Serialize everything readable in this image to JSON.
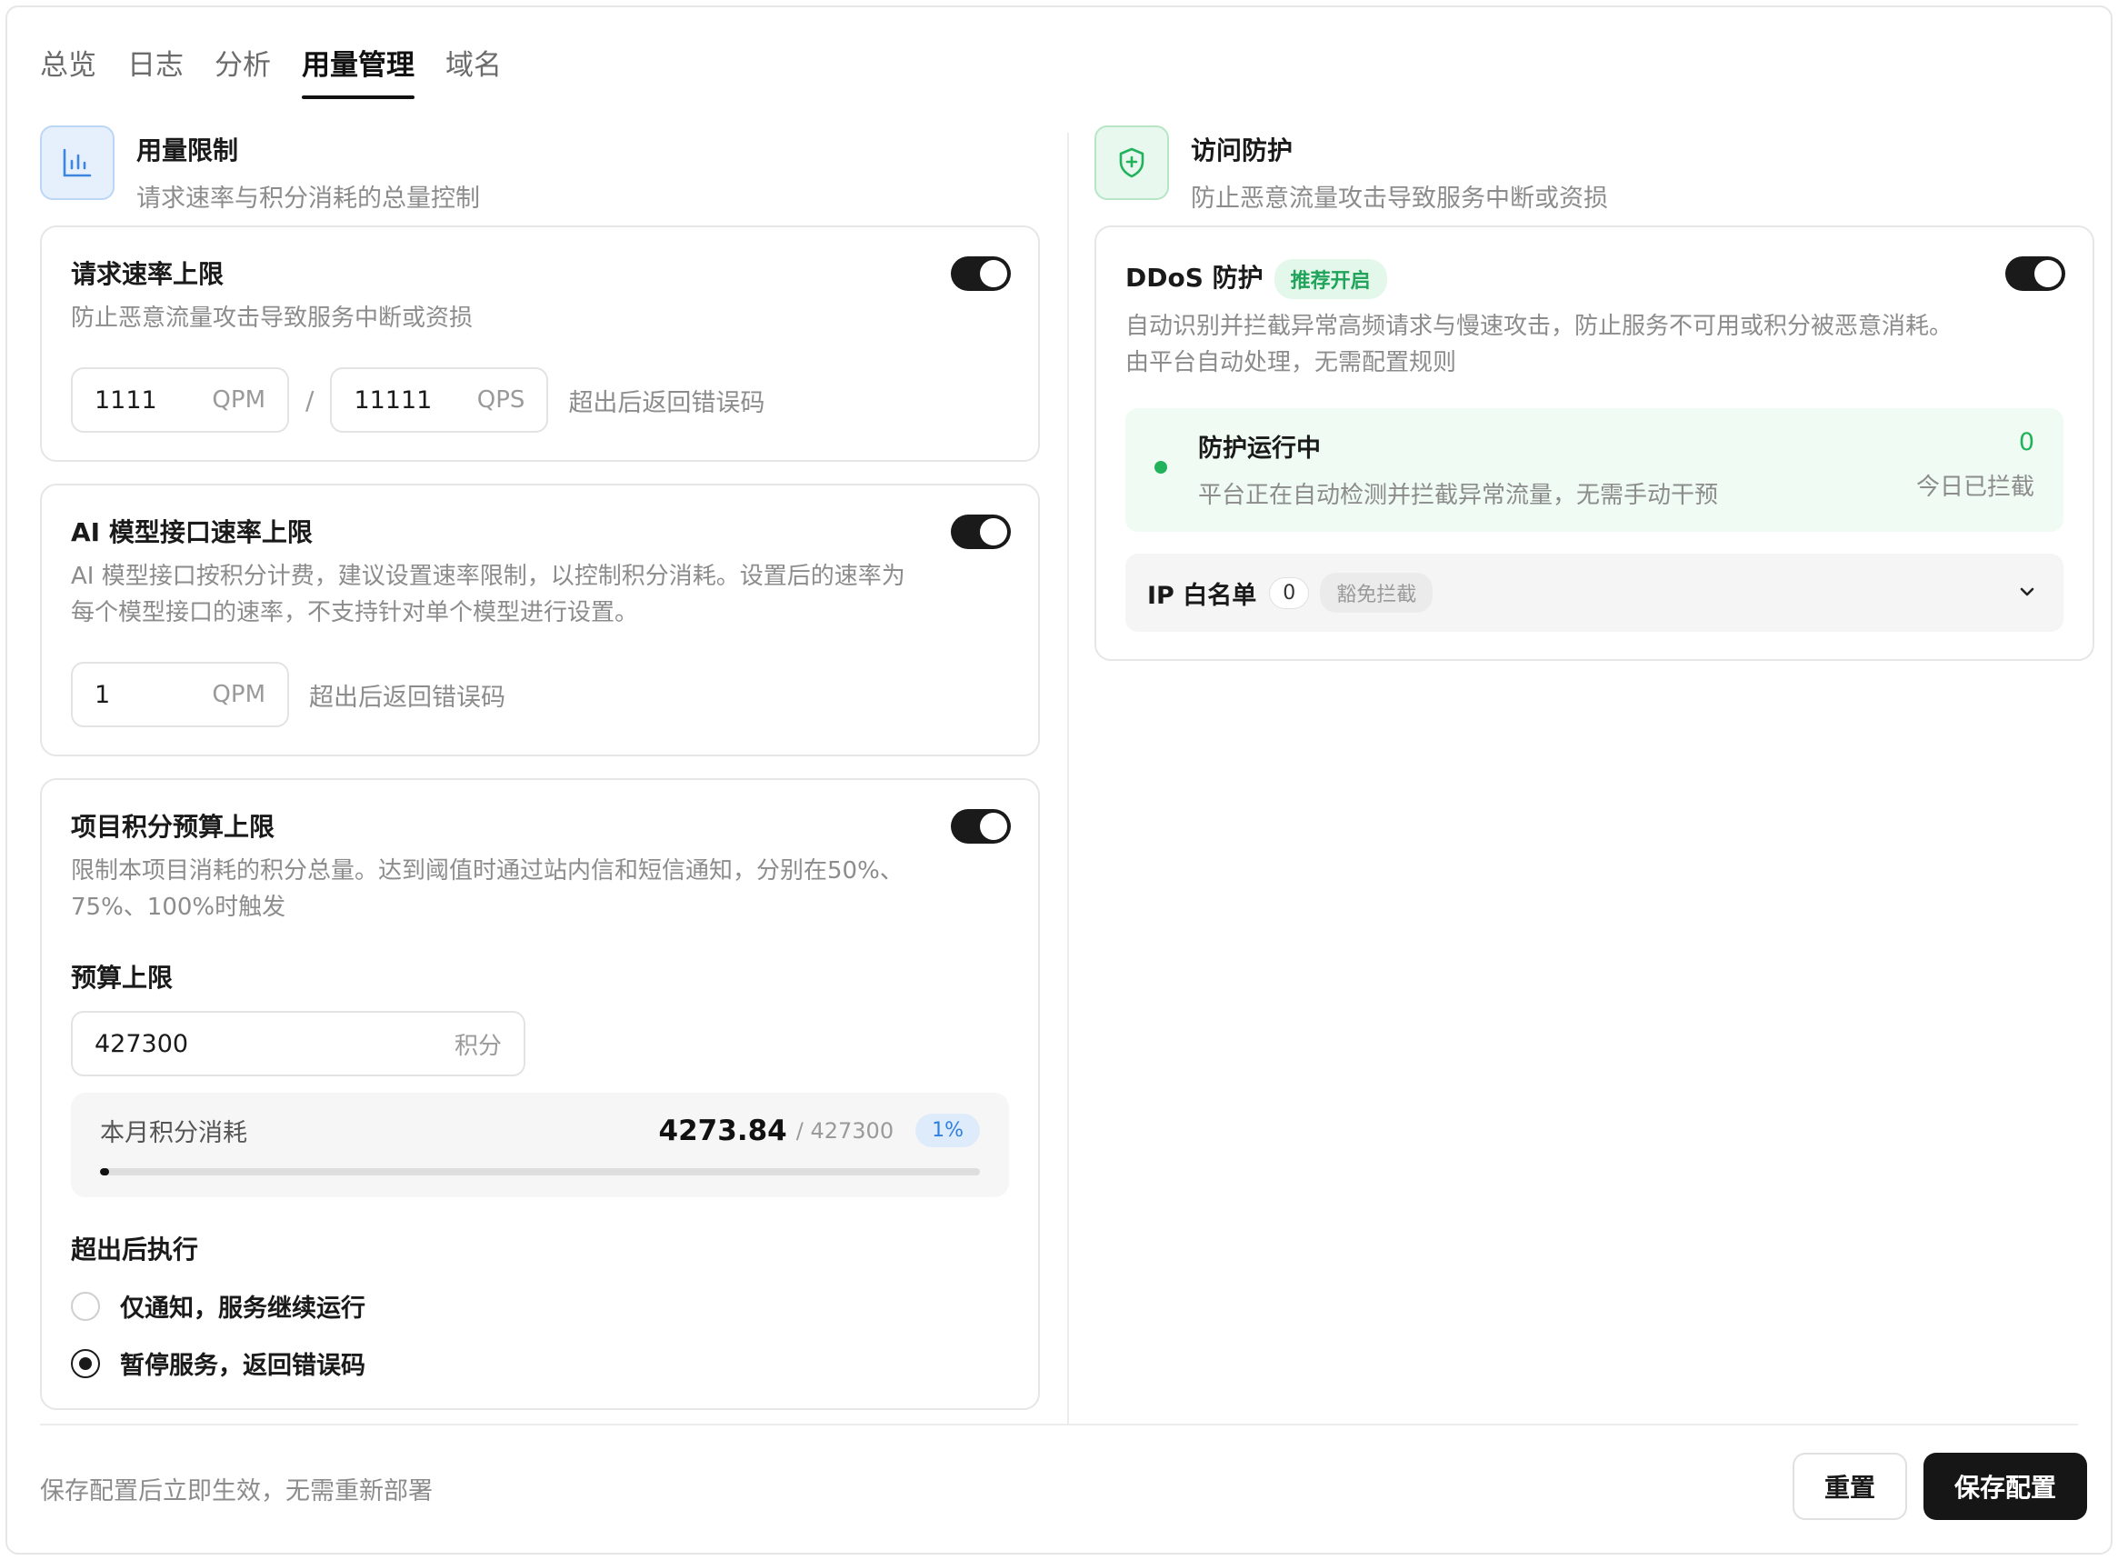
{
  "tabs": [
    {
      "label": "总览"
    },
    {
      "label": "日志"
    },
    {
      "label": "分析"
    },
    {
      "label": "用量管理"
    },
    {
      "label": "域名"
    }
  ],
  "active_tab": "用量管理",
  "left": {
    "title": "用量限制",
    "subtitle": "请求速率与积分消耗的总量控制",
    "icon": "bar-chart-icon",
    "rate": {
      "title": "请求速率上限",
      "desc": "防止恶意流量攻击导致服务中断或资损",
      "enabled": true,
      "qpm_value": "1111",
      "qpm_unit": "QPM",
      "slash": "/",
      "qps_value": "11111",
      "qps_unit": "QPS",
      "hint": "超出后返回错误码"
    },
    "ai": {
      "title": "AI 模型接口速率上限",
      "desc": "AI 模型接口按积分计费，建议设置速率限制，以控制积分消耗。设置后的速率为每个模型接口的速率，不支持针对单个模型进行设置。",
      "enabled": true,
      "qpm_value": "1",
      "qpm_unit": "QPM",
      "hint": "超出后返回错误码"
    },
    "budget": {
      "title": "项目积分预算上限",
      "desc": "限制本项目消耗的积分总量。达到阈值时通过站内信和短信通知，分别在50%、75%、100%时触发",
      "enabled": true,
      "limit_label": "预算上限",
      "limit_value": "427300",
      "limit_unit": "积分",
      "usage_label": "本月积分消耗",
      "usage_value": "4273.84",
      "usage_max": "/ 427300",
      "usage_pct": "1%",
      "usage_fraction": 0.01,
      "action_label": "超出后执行",
      "options": [
        {
          "label": "仅通知，服务继续运行",
          "checked": false
        },
        {
          "label": "暂停服务，返回错误码",
          "checked": true
        }
      ]
    }
  },
  "right": {
    "title": "访问防护",
    "subtitle": "防止恶意流量攻击导致服务中断或资损",
    "icon": "shield-plus-icon",
    "ddos": {
      "title": "DDoS 防护",
      "badge": "推荐开启",
      "enabled": true,
      "desc": "自动识别并拦截异常高频请求与慢速攻击，防止服务不可用或积分被恶意消耗。由平台自动处理，无需配置规则",
      "status_title": "防护运行中",
      "status_sub": "平台正在自动检测并拦截异常流量，无需手动干预",
      "blocked_count": "0",
      "blocked_label": "今日已拦截"
    },
    "whitelist": {
      "title": "IP 白名单",
      "count": "0",
      "tag": "豁免拦截"
    }
  },
  "footer": {
    "hint": "保存配置后立即生效，无需重新部署",
    "reset_label": "重置",
    "save_label": "保存配置"
  },
  "colors": {
    "accent_dark": "#161616",
    "success": "#22b25c",
    "info": "#2f7fde"
  }
}
